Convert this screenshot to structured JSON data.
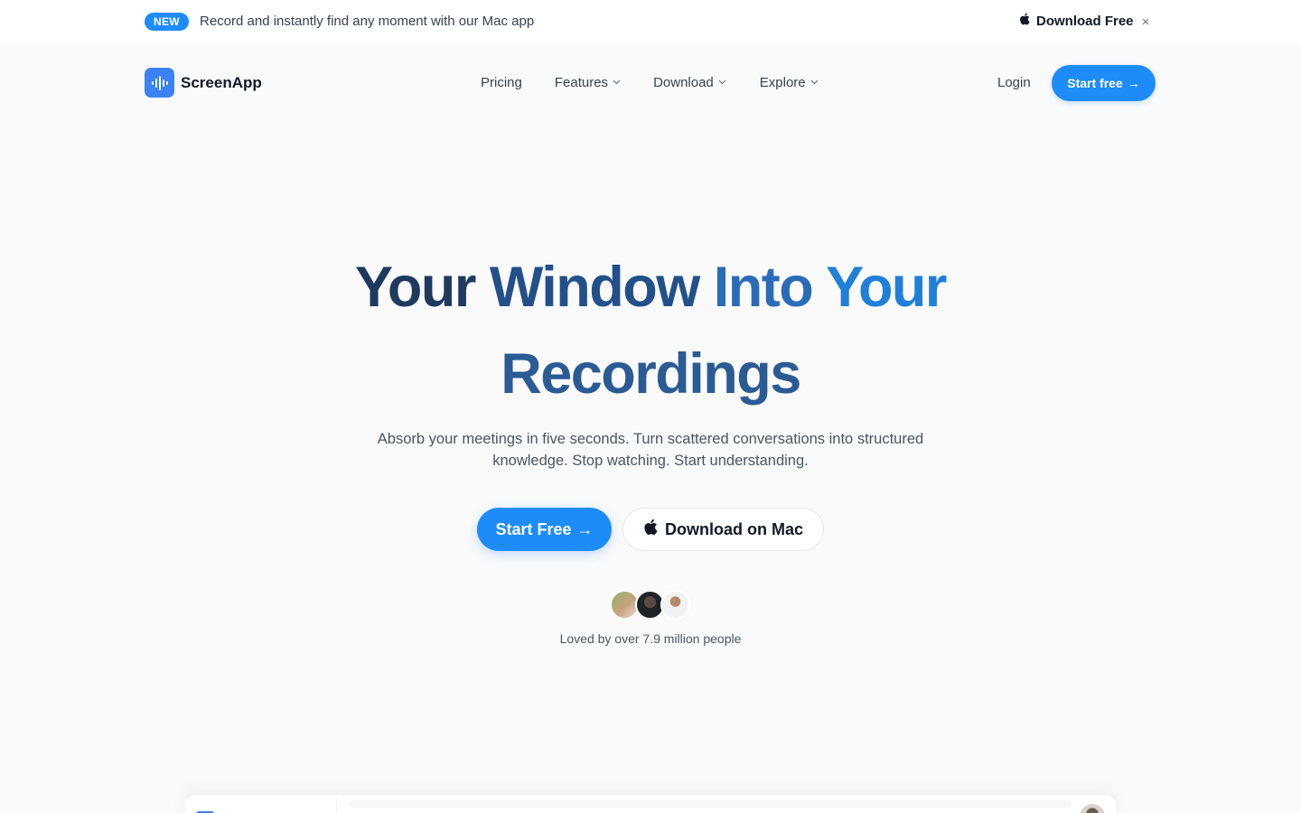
{
  "announcement": {
    "badge": "NEW",
    "message": "Record and instantly find any moment with our Mac app",
    "download_label": "Download Free",
    "close_symbol": "×",
    "download_icon": "apple-icon"
  },
  "nav": {
    "logo_text": "ScreenApp",
    "logo_icon": "waveform-icon",
    "menu": [
      {
        "label": "Pricing",
        "has_dropdown": false
      },
      {
        "label": "Features",
        "has_dropdown": true
      },
      {
        "label": "Download",
        "has_dropdown": true
      },
      {
        "label": "Explore",
        "has_dropdown": true
      }
    ],
    "login_label": "Login",
    "start_label": "Start free",
    "arrow": "→"
  },
  "hero": {
    "title_words": [
      "Your",
      "Window",
      "Into",
      "Your"
    ],
    "title_line2": "Recordings",
    "subtitle": "Absorb your meetings in five seconds. Turn scattered conversations into structured knowledge. Stop watching. Start understanding.",
    "primary_cta": "Start Free",
    "secondary_cta": "Download on Mac",
    "social_proof": "Loved by over 7.9 million people"
  },
  "colors": {
    "accent": "#1d8cf8",
    "title_dark": "#1e3a5f",
    "title_light": "#1f7fd9",
    "background": "#fafafa"
  }
}
